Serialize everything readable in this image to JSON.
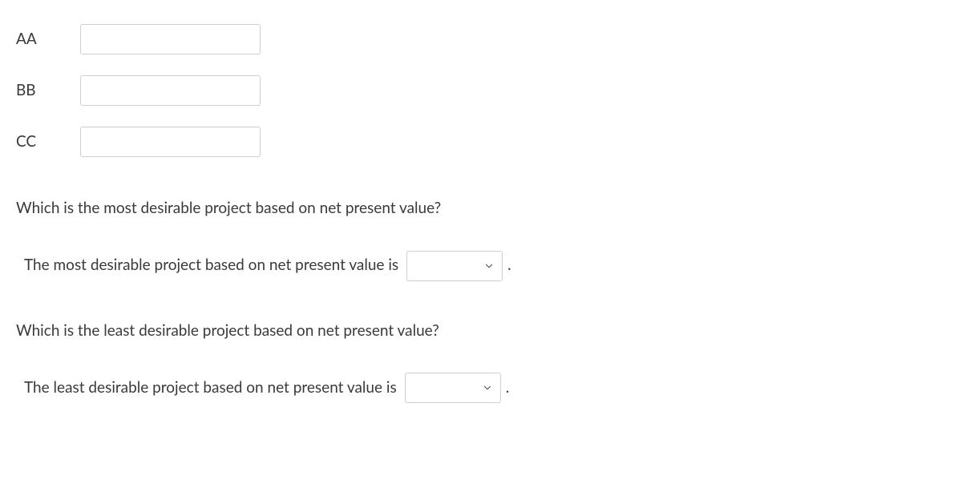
{
  "projects": {
    "rows": [
      {
        "label": "AA",
        "value": ""
      },
      {
        "label": "BB",
        "value": ""
      },
      {
        "label": "CC",
        "value": ""
      }
    ]
  },
  "questions": {
    "most": {
      "prompt": "Which is the most desirable project based on net present value?",
      "answer_prefix": "The most desirable project based on net present value is",
      "selected": "",
      "punctuation": "."
    },
    "least": {
      "prompt": "Which is the least desirable project based on net present value?",
      "answer_prefix": "The least desirable project based on net present value is",
      "selected": "",
      "punctuation": "."
    }
  }
}
